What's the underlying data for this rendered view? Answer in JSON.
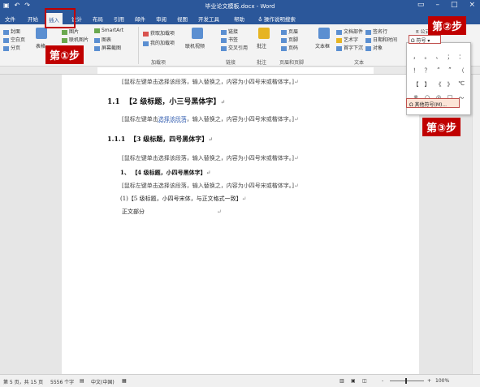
{
  "titlebar": {
    "doc_title": "毕业论文模板.docx - Word",
    "qat_icons": [
      "save-icon",
      "undo-icon",
      "redo-icon"
    ],
    "win_buttons": [
      "ribbon-display-icon",
      "minimize-icon",
      "maximize-icon",
      "close-icon"
    ]
  },
  "tabs": [
    {
      "label": "文件"
    },
    {
      "label": "开始"
    },
    {
      "label": "插入"
    },
    {
      "label": "设计"
    },
    {
      "label": "布局"
    },
    {
      "label": "引用"
    },
    {
      "label": "邮件"
    },
    {
      "label": "审阅"
    },
    {
      "label": "视图"
    },
    {
      "label": "开发工具"
    },
    {
      "label": "帮助"
    }
  ],
  "tell_me": "操作说明搜索",
  "ribbon": {
    "pages_group": {
      "cover": "封面",
      "blank": "空白页",
      "break": "分页"
    },
    "table_label": "表格",
    "illustrations": {
      "picture": "图片",
      "online_pic": "联机图片",
      "smartart": "SmartArt",
      "chart": "图表",
      "screenshot": "屏幕截图"
    },
    "addins": {
      "get": "获取加载项",
      "mine": "我的加载项",
      "group": "加载项"
    },
    "media": {
      "video": "联机视频"
    },
    "links": {
      "link": "链接",
      "bookmark": "书签",
      "crossref": "交叉引用",
      "group": "链接"
    },
    "comments": {
      "comment": "批注",
      "group": "批注"
    },
    "header_footer": {
      "header": "页眉",
      "footer": "页脚",
      "page_no": "页码",
      "group": "页眉和页脚"
    },
    "text": {
      "textbox": "文本框",
      "quickparts": "文档部件",
      "wordart": "艺术字",
      "dropcap": "首字下沉",
      "signature": "签名行",
      "datetime": "日期和时间",
      "object": "对象",
      "group": "文本"
    },
    "symbols": {
      "equation": "公式",
      "symbol": "符号"
    }
  },
  "symbol_dropdown": {
    "glyphs": [
      "，",
      "。",
      "、",
      "；",
      "：",
      "！",
      "？",
      "“",
      "”",
      "（",
      "【",
      "】",
      "《",
      "》",
      "℃",
      "※",
      "○",
      "◎",
      "□",
      "～"
    ],
    "more_label": "其他符号(M)..."
  },
  "document": {
    "lines": [
      {
        "type": "ph",
        "text": "[鼠标左键单击选择该段落，输入替换之，内容为小四号宋或楷体字。]"
      },
      {
        "type": "h2",
        "num": "1.1",
        "text": "【2 级标题，小三号黑体字】"
      },
      {
        "type": "ph",
        "text_pre": "[鼠标左键单击",
        "text_sel": "选择该段落",
        "text_post": "，输入替换之，内容为小四号宋或楷体字。]"
      },
      {
        "type": "h3",
        "num": "1.1.1",
        "text": "【3 级标题，四号黑体字】"
      },
      {
        "type": "ph",
        "text": "[鼠标左键单击选择该段落，输入替换之，内容为小四号宋或楷体字。]"
      },
      {
        "type": "h4",
        "num": "1、",
        "text": "【4 级标题，小四号黑体字】"
      },
      {
        "type": "ph",
        "text": "[鼠标左键单击选择该段落，输入替换之，内容为小四号宋或楷体字。]"
      },
      {
        "type": "h5",
        "num": "(1)",
        "text": "【5 级标题，小四号宋体，与正文格式一致】"
      },
      {
        "type": "body",
        "text": "正文部分"
      }
    ],
    "para_mark": "↵"
  },
  "callouts": {
    "step1": "第①步",
    "step2": "第②步",
    "step3": "第③步"
  },
  "statusbar": {
    "page": "第 5 页，共 15 页",
    "words": "5556 个字",
    "lang": "中文(中国)",
    "zoom": "100%",
    "zoom_minus": "-",
    "zoom_plus": "+"
  },
  "colors": {
    "brand": "#2b579a",
    "callout": "#c00000",
    "highlight": "#fce4d6"
  }
}
